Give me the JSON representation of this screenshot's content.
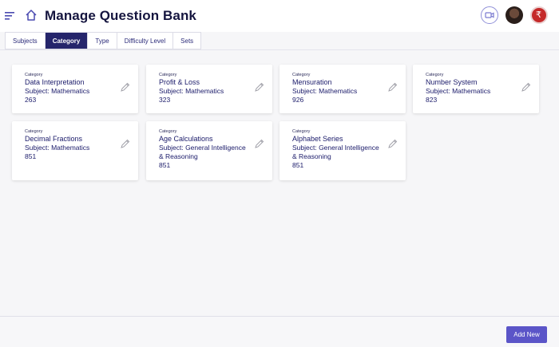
{
  "header": {
    "title": "Manage Question Bank"
  },
  "tabs": [
    {
      "label": "Subjects",
      "active": false
    },
    {
      "label": "Category",
      "active": true
    },
    {
      "label": "Type",
      "active": false
    },
    {
      "label": "Difficulty Level",
      "active": false
    },
    {
      "label": "Sets",
      "active": false
    }
  ],
  "cards": [
    {
      "label": "Category",
      "name": "Data Interpretation",
      "subject": "Subject: Mathematics",
      "subject2": "",
      "count": "263"
    },
    {
      "label": "Category",
      "name": "Profit & Loss",
      "subject": "Subject: Mathematics",
      "subject2": "",
      "count": "323"
    },
    {
      "label": "Category",
      "name": "Mensuration",
      "subject": "Subject: Mathematics",
      "subject2": "",
      "count": "926"
    },
    {
      "label": "Category",
      "name": "Number System",
      "subject": "Subject: Mathematics",
      "subject2": "",
      "count": "823"
    },
    {
      "label": "Category",
      "name": "Decimal Fractions",
      "subject": "Subject: Mathematics",
      "subject2": "",
      "count": "851"
    },
    {
      "label": "Category",
      "name": "Age Calculations",
      "subject": "Subject: General Intelligence",
      "subject2": "& Reasoning",
      "count": "851"
    },
    {
      "label": "Category",
      "name": "Alphabet Series",
      "subject": "Subject: General Intelligence",
      "subject2": "& Reasoning",
      "count": "851"
    }
  ],
  "footer": {
    "add_label": "Add New"
  },
  "colors": {
    "accent": "#25256b",
    "button": "#5b55c8",
    "text": "#1b1b6a"
  },
  "icons": {
    "menu": "menu-icon",
    "home": "home-icon",
    "video": "video-call-icon",
    "avatar": "user-avatar",
    "badge": "coin-badge-icon",
    "edit": "pencil-edit-icon"
  }
}
